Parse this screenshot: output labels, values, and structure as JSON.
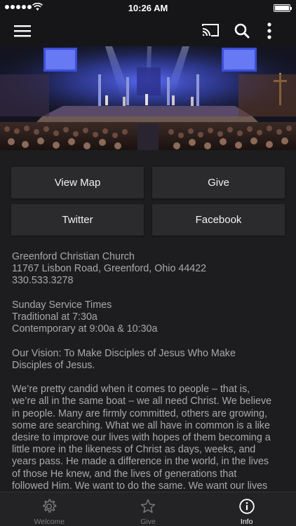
{
  "status_bar": {
    "time": "10:26 AM"
  },
  "nav": {
    "icons": [
      "hamburger-menu-icon",
      "cast-icon",
      "search-icon",
      "more-vertical-icon"
    ]
  },
  "buttons": {
    "view_map": "View Map",
    "give": "Give",
    "twitter": "Twitter",
    "facebook": "Facebook"
  },
  "info": {
    "church_name": "Greenford Christian Church",
    "address": "11767 Lisbon Road, Greenford, Ohio  44422",
    "phone": "330.533.3278",
    "service_heading": "Sunday Service Times",
    "service_traditional": "Traditional at 7:30a",
    "service_contemporary": "Contemporary at 9:00a & 10:30a",
    "vision_line1": "Our Vision: To Make Disciples of Jesus Who Make",
    "vision_line2": "Disciples of Jesus.",
    "about_lines": [
      "We’re pretty candid when it comes to people – that is,",
      "we’re all in the same boat – we all need Christ. We believe",
      "in people. Many are firmly committed, others are growing,",
      "some are searching. What we all have in common is a like",
      "desire to improve our lives with hopes of them becoming a",
      "little more in the likeness of Christ as days, weeks, and",
      "years pass. He made a difference in the world, in the lives",
      "of those He knew, and the lives of generations that",
      "followed Him. We want to do the same. We want our lives"
    ]
  },
  "tabs": [
    {
      "label": "Welcome",
      "icon": "gear-icon",
      "active": false
    },
    {
      "label": "Give",
      "icon": "star-icon",
      "active": false
    },
    {
      "label": "Info",
      "icon": "info-icon",
      "active": true
    }
  ],
  "colors": {
    "background": "#1d1d1f",
    "button": "#2b2b2d",
    "text": "#a9a9ab",
    "tab_active": "#ffffff",
    "tab_inactive": "#7c7c80"
  }
}
